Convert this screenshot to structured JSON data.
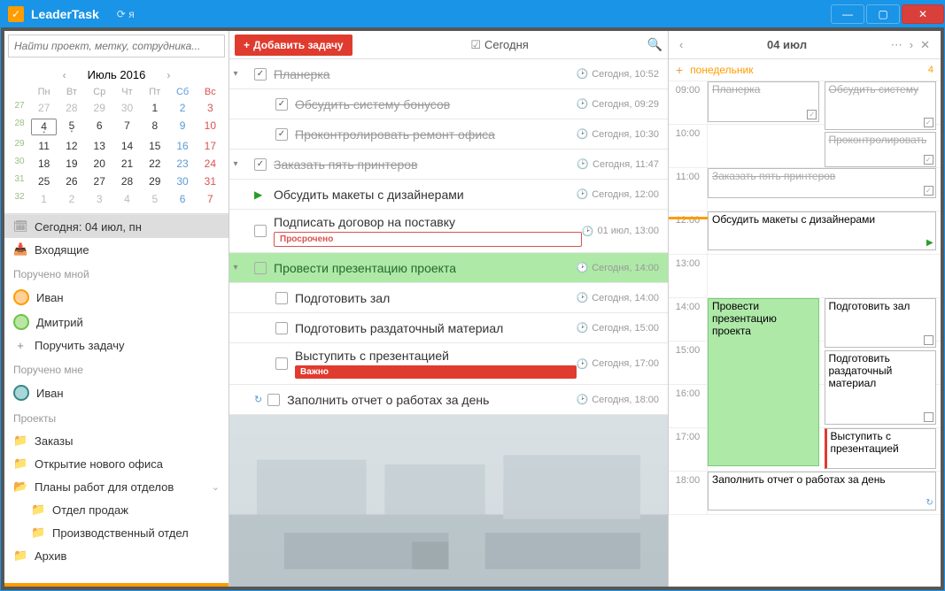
{
  "titlebar": {
    "app_name": "LeaderTask",
    "sync_label": "я"
  },
  "search": {
    "placeholder": "Найти проект, метку, сотрудника..."
  },
  "calendar": {
    "title": "Июль 2016",
    "dow": [
      "Пн",
      "Вт",
      "Ср",
      "Чт",
      "Пт",
      "Сб",
      "Вс"
    ],
    "weeks": [
      {
        "wk": "27",
        "days": [
          {
            "n": "27",
            "dim": true
          },
          {
            "n": "28",
            "dim": true
          },
          {
            "n": "29",
            "dim": true
          },
          {
            "n": "30",
            "dim": true
          },
          {
            "n": "1"
          },
          {
            "n": "2",
            "sat": true
          },
          {
            "n": "3",
            "sun": true
          }
        ]
      },
      {
        "wk": "28",
        "days": [
          {
            "n": "4",
            "sel": true,
            "dot": true
          },
          {
            "n": "5",
            "dot": true
          },
          {
            "n": "6"
          },
          {
            "n": "7"
          },
          {
            "n": "8"
          },
          {
            "n": "9",
            "sat": true
          },
          {
            "n": "10",
            "sun": true
          }
        ]
      },
      {
        "wk": "29",
        "days": [
          {
            "n": "11"
          },
          {
            "n": "12"
          },
          {
            "n": "13"
          },
          {
            "n": "14"
          },
          {
            "n": "15"
          },
          {
            "n": "16",
            "sat": true
          },
          {
            "n": "17",
            "sun": true
          }
        ]
      },
      {
        "wk": "30",
        "days": [
          {
            "n": "18"
          },
          {
            "n": "19"
          },
          {
            "n": "20"
          },
          {
            "n": "21"
          },
          {
            "n": "22"
          },
          {
            "n": "23",
            "sat": true
          },
          {
            "n": "24",
            "sun": true
          }
        ]
      },
      {
        "wk": "31",
        "days": [
          {
            "n": "25"
          },
          {
            "n": "26"
          },
          {
            "n": "27"
          },
          {
            "n": "28"
          },
          {
            "n": "29"
          },
          {
            "n": "30",
            "sat": true
          },
          {
            "n": "31",
            "sun": true
          }
        ]
      },
      {
        "wk": "32",
        "days": [
          {
            "n": "1",
            "dim": true
          },
          {
            "n": "2",
            "dim": true
          },
          {
            "n": "3",
            "dim": true
          },
          {
            "n": "4",
            "dim": true
          },
          {
            "n": "5",
            "dim": true
          },
          {
            "n": "6",
            "dim": true,
            "sat": true
          },
          {
            "n": "7",
            "dim": true,
            "sun": true
          }
        ]
      }
    ]
  },
  "nav": {
    "today": "Сегодня: 04 июл, пн",
    "inbox": "Входящие",
    "assigned_by_me": "Поручено мной",
    "ivan": "Иван",
    "dmitry": "Дмитрий",
    "assign_task": "Поручить задачу",
    "assigned_to_me": "Поручено мне",
    "projects": "Проекты",
    "orders": "Заказы",
    "new_office": "Открытие нового офиса",
    "dept_plans": "Планы работ для отделов",
    "sales_dept": "Отдел продаж",
    "prod_dept": "Производственный отдел",
    "archive": "Архив"
  },
  "toolbar": {
    "add_task": "Добавить задачу",
    "filter_today": "Сегодня"
  },
  "tasks": [
    {
      "level": 0,
      "done": true,
      "collapse": "▾",
      "title": "Планерка",
      "time": "Сегодня, 10:52"
    },
    {
      "level": 1,
      "done": true,
      "title": "Обсудить систему бонусов",
      "time": "Сегодня, 09:29"
    },
    {
      "level": 1,
      "done": true,
      "title": "Проконтролировать ремонт офиса",
      "time": "Сегодня, 10:30"
    },
    {
      "level": 0,
      "done": true,
      "collapse": "▾",
      "title": "Заказать пять принтеров",
      "time": "Сегодня, 11:47"
    },
    {
      "level": 0,
      "play": true,
      "title": "Обсудить макеты с дизайнерами",
      "time": "Сегодня, 12:00"
    },
    {
      "level": 0,
      "title": "Подписать договор на поставку",
      "time": "01 июл, 13:00",
      "tag": "overdue",
      "tag_text": "Просрочено"
    },
    {
      "level": 0,
      "hl": true,
      "collapse": "▾",
      "title": "Провести презентацию проекта",
      "time": "Сегодня, 14:00"
    },
    {
      "level": 1,
      "title": "Подготовить зал",
      "time": "Сегодня, 14:00"
    },
    {
      "level": 1,
      "title": "Подготовить раздаточный материал",
      "time": "Сегодня, 15:00"
    },
    {
      "level": 1,
      "title": "Выступить с презентацией",
      "time": "Сегодня, 17:00",
      "tag": "important",
      "tag_text": "Важно"
    },
    {
      "level": 0,
      "repeat": true,
      "title": "Заполнить отчет о работах за день",
      "time": "Сегодня, 18:00"
    }
  ],
  "right": {
    "date": "04 июл",
    "day_name": "понедельник",
    "count": "4",
    "hours": [
      "09:00",
      "10:00",
      "11:00",
      "12:00",
      "13:00",
      "14:00",
      "15:00",
      "16:00",
      "17:00",
      "18:00"
    ],
    "events": {
      "e1": "Планерка",
      "e2": "Обсудить систему",
      "e3": "Проконтролировать",
      "e4": "Заказать пять принтеров",
      "e5": "Обсудить макеты с дизайнерами",
      "e6": "Провести презентацию проекта",
      "e7": "Подготовить зал",
      "e8": "Подготовить раздаточный материал",
      "e9": "Выступить с презентацией",
      "e10": "Заполнить отчет о работах за день"
    }
  }
}
